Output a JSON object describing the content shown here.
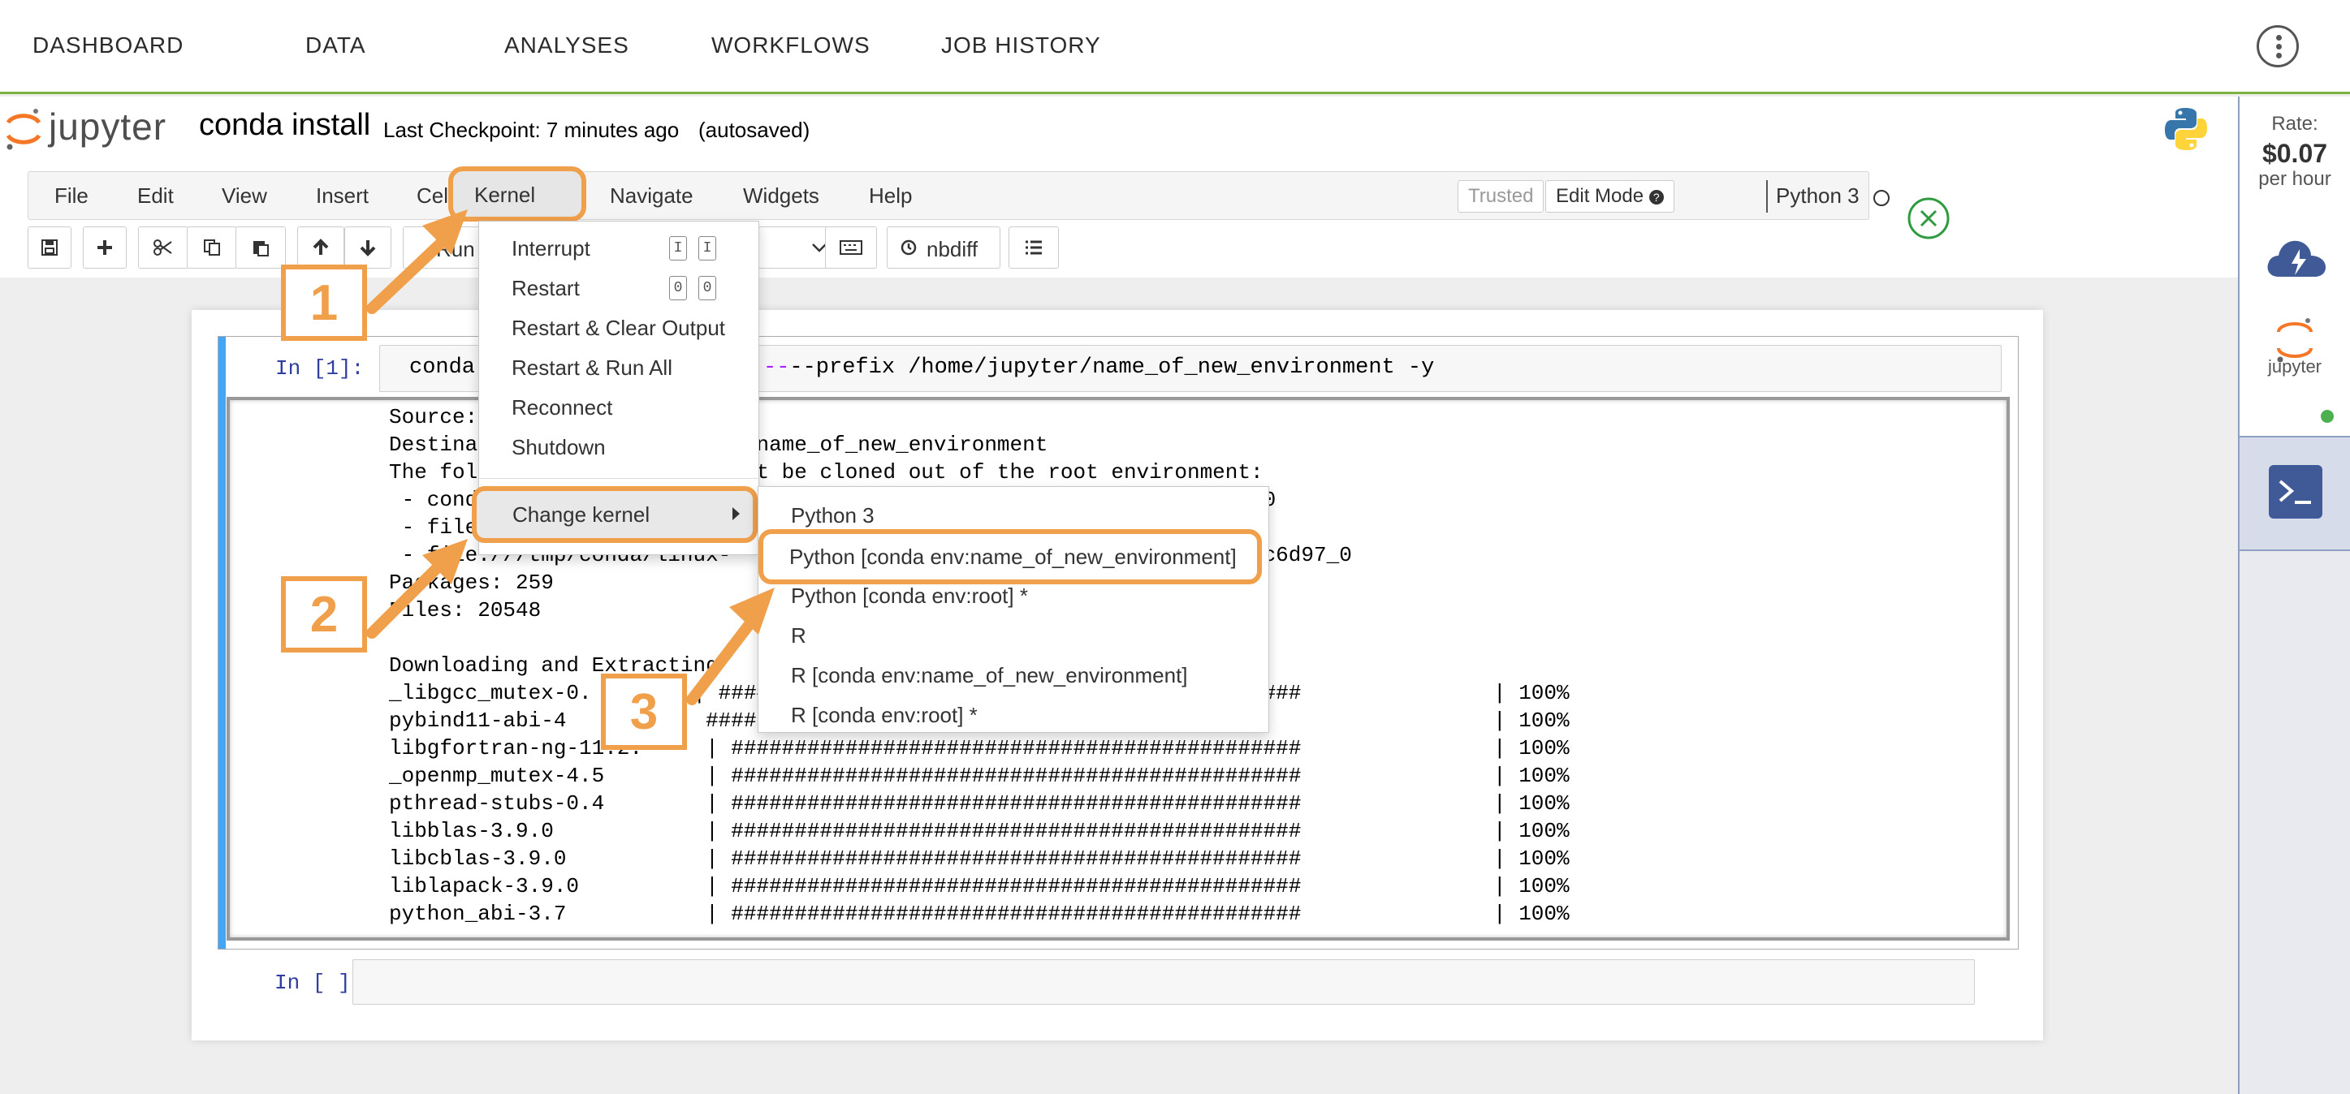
{
  "topnav": {
    "items": [
      "DASHBOARD",
      "DATA",
      "ANALYSES",
      "WORKFLOWS",
      "JOB HISTORY"
    ]
  },
  "header": {
    "logo_text": "jupyter",
    "notebook_name": "conda install",
    "checkpoint": "Last Checkpoint: 7 minutes ago",
    "autosaved": "(autosaved)"
  },
  "menubar": {
    "items": [
      "File",
      "Edit",
      "View",
      "Insert",
      "Cell",
      "Kernel",
      "Navigate",
      "Widgets",
      "Help"
    ],
    "trusted": "Trusted",
    "edit_mode": "Edit Mode",
    "kernel_name": "Python 3"
  },
  "toolbar": {
    "run_partial": "Run",
    "nbdiff": "nbdiff"
  },
  "kernel_menu": {
    "items": [
      {
        "label": "Interrupt",
        "keys": [
          "I",
          "I"
        ]
      },
      {
        "label": "Restart",
        "keys": [
          "0",
          "0"
        ]
      },
      {
        "label": "Restart & Clear Output"
      },
      {
        "label": "Restart & Run All"
      },
      {
        "label": "Reconnect"
      },
      {
        "label": "Shutdown"
      }
    ],
    "change_kernel": "Change kernel"
  },
  "kernel_submenu": {
    "items": [
      "Python 3",
      "Python [conda env:name_of_new_environment]",
      "Python [conda env:root] *",
      "R",
      "R [conda env:name_of_new_environment]",
      "R [conda env:root] *"
    ]
  },
  "cell1": {
    "prompt": "In [1]:",
    "code_start": "conda",
    "code_end": "--prefix /home/jupyter/name_of_new_environment -y",
    "output_lines": [
      "Source:",
      "Destina                      name_of_new_environment",
      "The fol                     ot be cloned out of the root environment:",
      " - cond                                                          c82_0",
      " - file",
      " - file:///tmp/conda/linux-                                      7h9fc6d97_0",
      "Packages: 259",
      "Files: 20548",
      "",
      "Downloading and Extracting",
      "_libgcc_mutex-0.        | ##############################################",
      "pybind11-abi-4           ####",
      "libgfortran-ng-11.2.     | #############################################",
      "_openmp_mutex-4.5        | #############################################",
      "pthread-stubs-0.4        | #############################################",
      "libblas-3.9.0            | #############################################",
      "libcblas-3.9.0           | #############################################",
      "liblapack-3.9.0          | #############################################",
      "python_abi-3.7           | #############################################"
    ],
    "progress_suffix": "| 100%"
  },
  "cell2": {
    "prompt": "In [ ]:"
  },
  "annotations": {
    "steps": [
      "1",
      "2",
      "3"
    ],
    "color": "#f0a04b"
  },
  "sidebar": {
    "rate_label": "Rate:",
    "rate_value": "$0.07",
    "rate_unit": "per hour",
    "jupyter_label": "jupyter"
  },
  "colors": {
    "accent_orange": "#f0a04b",
    "cell_blue": "#42a5f5",
    "topnav_underline": "#7cb342",
    "sidebar_blue": "#3f5a96"
  }
}
